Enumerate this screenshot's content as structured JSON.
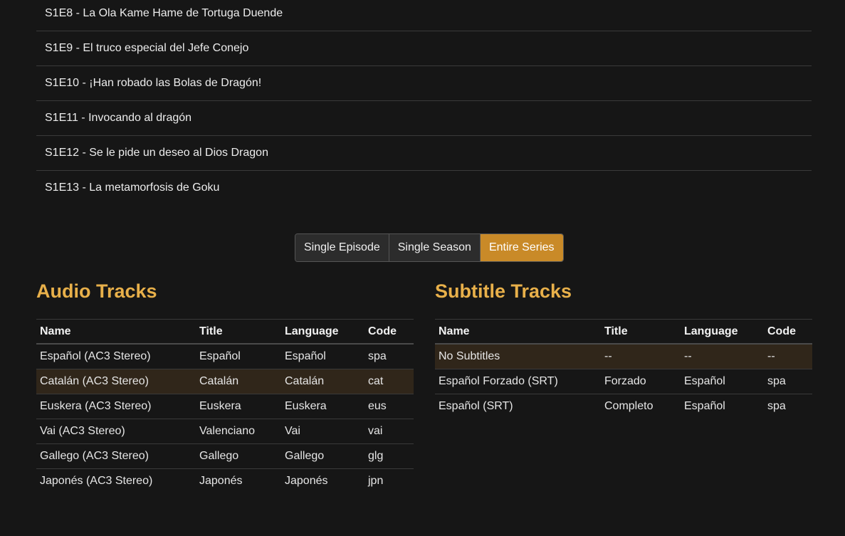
{
  "episodes": [
    "S1E8 - La Ola Kame Hame de Tortuga Duende",
    "S1E9 - El truco especial del Jefe Conejo",
    "S1E10 - ¡Han robado las Bolas de Dragón!",
    "S1E11 - Invocando al dragón",
    "S1E12 - Se le pide un deseo al Dios Dragon",
    "S1E13 - La metamorfosis de Goku"
  ],
  "scope": {
    "single_episode": "Single Episode",
    "single_season": "Single Season",
    "entire_series": "Entire Series",
    "selected": "entire_series"
  },
  "audio": {
    "heading": "Audio Tracks",
    "columns": [
      "Name",
      "Title",
      "Language",
      "Code"
    ],
    "selected_row": 1,
    "rows": [
      [
        "Español (AC3 Stereo)",
        "Español",
        "Español",
        "spa"
      ],
      [
        "Catalán (AC3 Stereo)",
        "Catalán",
        "Catalán",
        "cat"
      ],
      [
        "Euskera (AC3 Stereo)",
        "Euskera",
        "Euskera",
        "eus"
      ],
      [
        "Vai (AC3 Stereo)",
        "Valenciano",
        "Vai",
        "vai"
      ],
      [
        "Gallego (AC3 Stereo)",
        "Gallego",
        "Gallego",
        "glg"
      ],
      [
        "Japonés (AC3 Stereo)",
        "Japonés",
        "Japonés",
        "jpn"
      ]
    ]
  },
  "subtitles": {
    "heading": "Subtitle Tracks",
    "columns": [
      "Name",
      "Title",
      "Language",
      "Code"
    ],
    "selected_row": 0,
    "rows": [
      [
        "No Subtitles",
        "--",
        "--",
        "--"
      ],
      [
        "Español Forzado (SRT)",
        "Forzado",
        "Español",
        "spa"
      ],
      [
        "Español (SRT)",
        "Completo",
        "Español",
        "spa"
      ]
    ]
  },
  "colors": {
    "background": "#161616",
    "accent": "#c98a28",
    "heading": "#e8b04a",
    "selected_row": "#30261a"
  }
}
